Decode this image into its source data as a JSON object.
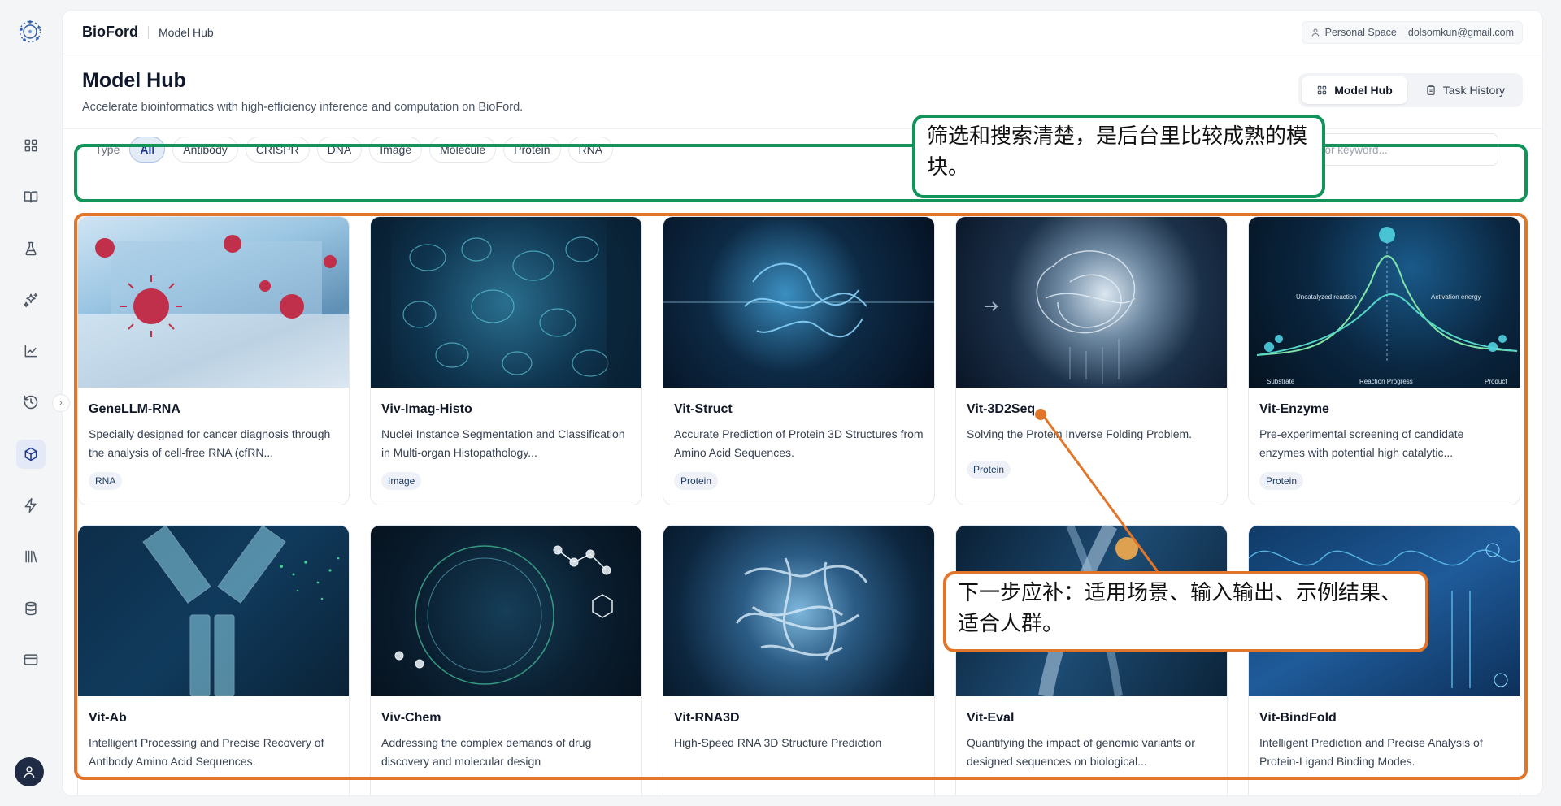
{
  "app": {
    "brand": "BioFord",
    "breadcrumb": "Model Hub",
    "personal_space": "Personal Space",
    "email": "dolsomkun@gmail.com"
  },
  "header": {
    "title": "Model Hub",
    "subtitle": "Accelerate bioinformatics with high-efficiency inference and computation on BioFord.",
    "tabs": [
      {
        "label": "Model Hub",
        "icon": "grid-icon",
        "active": true
      },
      {
        "label": "Task History",
        "icon": "clipboard-icon",
        "active": false
      }
    ]
  },
  "filters": {
    "type_label": "Type",
    "chips": [
      "All",
      "Antibody",
      "CRISPR",
      "DNA",
      "Image",
      "Molecule",
      "Protein",
      "RNA"
    ],
    "active": "All",
    "search_placeholder": "by name or keyword..."
  },
  "cards": [
    {
      "name": "GeneLLM-RNA",
      "desc": "Specially designed for cancer diagnosis through the analysis of cell-free RNA (cfRN...",
      "tag": "RNA"
    },
    {
      "name": "Viv-Imag-Histo",
      "desc": "Nuclei Instance Segmentation and Classification in Multi-organ Histopathology...",
      "tag": "Image"
    },
    {
      "name": "Vit-Struct",
      "desc": "Accurate Prediction of Protein 3D Structures from Amino Acid Sequences.",
      "tag": "Protein"
    },
    {
      "name": "Vit-3D2Seq",
      "desc": "Solving the Protein Inverse Folding Problem.",
      "tag": "Protein"
    },
    {
      "name": "Vit-Enzyme",
      "desc": "Pre-experimental screening of candidate enzymes with potential high catalytic...",
      "tag": "Protein"
    },
    {
      "name": "Vit-Ab",
      "desc": "Intelligent Processing and Precise Recovery of Antibody Amino Acid Sequences.",
      "tag": ""
    },
    {
      "name": "Viv-Chem",
      "desc": "Addressing the complex demands of drug discovery and molecular design",
      "tag": ""
    },
    {
      "name": "Vit-RNA3D",
      "desc": "High-Speed RNA 3D Structure Prediction",
      "tag": ""
    },
    {
      "name": "Vit-Eval",
      "desc": "Quantifying the impact of genomic variants or designed sequences on biological...",
      "tag": ""
    },
    {
      "name": "Vit-BindFold",
      "desc": "Intelligent Prediction and Precise Analysis of Protein-Ligand Binding Modes.",
      "tag": ""
    }
  ],
  "enzyme_image_text": {
    "uncatalyzed": "Uncatalyzed reaction",
    "activation": "Activation energy",
    "substrate": "Substrate",
    "progress": "Reaction Progress",
    "product": "Product"
  },
  "annotations": {
    "green_note": "筛选和搜索清楚，是后台里比较成熟的模块。",
    "orange_note": "下一步应补：适用场景、输入输出、示例结果、适合人群。",
    "green_color": "#12935a",
    "orange_color": "#e1762a"
  },
  "sidebar_icons": [
    "grid-icon",
    "book-icon",
    "flask-icon",
    "sparkle-icon",
    "chart-icon",
    "history-icon",
    "cube-icon",
    "bolt-icon",
    "library-icon",
    "database-icon",
    "card-icon"
  ]
}
